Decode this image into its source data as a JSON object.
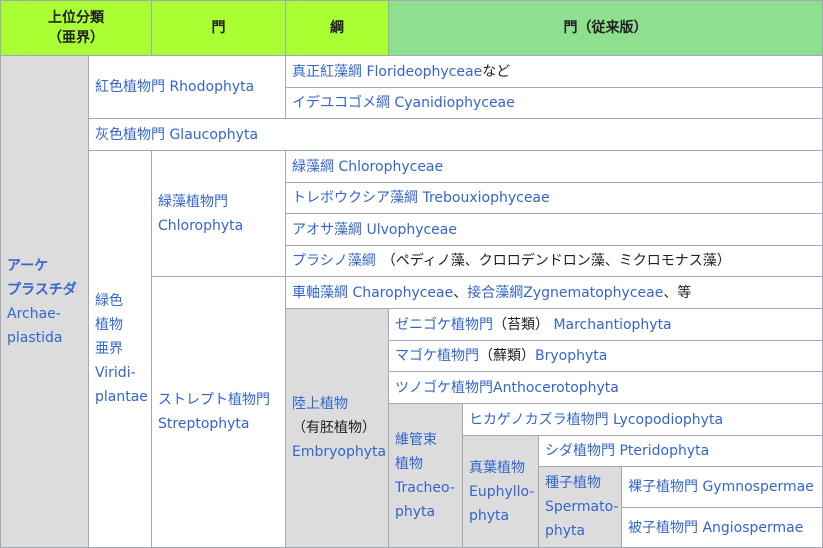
{
  "headers": {
    "superclass_l1": "上位分類",
    "superclass_l2": "（亜界）",
    "phylum": "門",
    "class": "綱",
    "traditional": "門（従来版）"
  },
  "archaeplastida": {
    "ja": "アーケ\nプラスチダ",
    "en_1": "Archae-",
    "en_2": "plastida"
  },
  "rhodophyta": {
    "ja": "紅色植物門",
    "en": "Rhodophyta"
  },
  "florideophyceae": {
    "ja": "真正紅藻綱",
    "en": "Florideophyceae",
    "suffix": "など"
  },
  "cyanidiophyceae": {
    "ja": "イデユコゴメ綱",
    "en": "Cyanidiophyceae"
  },
  "glaucophyta": {
    "ja": "灰色植物門",
    "en": "Glaucophyta"
  },
  "viridiplantae": {
    "ja_1": "緑色",
    "ja_2": "植物",
    "ja_3": "亜界",
    "en_1": "Viridi-",
    "en_2": "plantae"
  },
  "chlorophyta": {
    "ja": "緑藻植物門",
    "en": "Chlorophyta"
  },
  "chlorophyceae": {
    "ja": "緑藻綱",
    "en": "Chlorophyceae"
  },
  "trebouxiophyceae": {
    "ja": "トレボウクシア藻綱",
    "en": "Trebouxiophyceae"
  },
  "ulvophyceae": {
    "ja": "アオサ藻綱",
    "en": "Ulvophyceae"
  },
  "prasinophyceae": {
    "ja": "プラシノ藻綱",
    "note": "（ペディノ藻、クロロデンドロン藻、ミクロモナス藻）"
  },
  "streptophyta": {
    "ja": "ストレプト植物門",
    "en": "Streptophyta"
  },
  "charophyceae": {
    "ja": "車軸藻綱",
    "en": "Charophyceae",
    "sep": "、",
    "ja2": "接合藻綱",
    "en2": "Zygnematophyceae",
    "suffix": "、等"
  },
  "embryophyta": {
    "ja": "陸上植物",
    "note": "（有胚植物）",
    "en": "Embryophyta"
  },
  "marchantiophyta": {
    "ja": "ゼニゴケ植物門",
    "note": "（苔類）",
    "en": "Marchantiophyta"
  },
  "bryophyta": {
    "ja": "マゴケ植物門",
    "note": "（蘚類）",
    "en": "Bryophyta"
  },
  "anthocerotophyta": {
    "ja": "ツノゴケ植物門",
    "en": "Anthocerotophyta"
  },
  "tracheophyta": {
    "ja_1": "維管束",
    "ja_2": "植物",
    "en_1": "Tracheo-",
    "en_2": "phyta"
  },
  "lycopodiophyta": {
    "ja": "ヒカゲノカズラ植物門",
    "en": "Lycopodiophyta"
  },
  "euphyllophyta": {
    "ja": "真葉植物",
    "en_1": "Euphyllo-",
    "en_2": "phyta"
  },
  "pteridophyta": {
    "ja": "シダ植物門",
    "en": "Pteridophyta"
  },
  "spermatophyta": {
    "ja": "種子植物",
    "en_1": "Spermato-",
    "en_2": "phyta"
  },
  "gymnospermae": {
    "ja": "裸子植物門",
    "en": "Gymnospermae"
  },
  "angiospermae": {
    "ja": "被子植物門",
    "en": "Angiospermae"
  }
}
